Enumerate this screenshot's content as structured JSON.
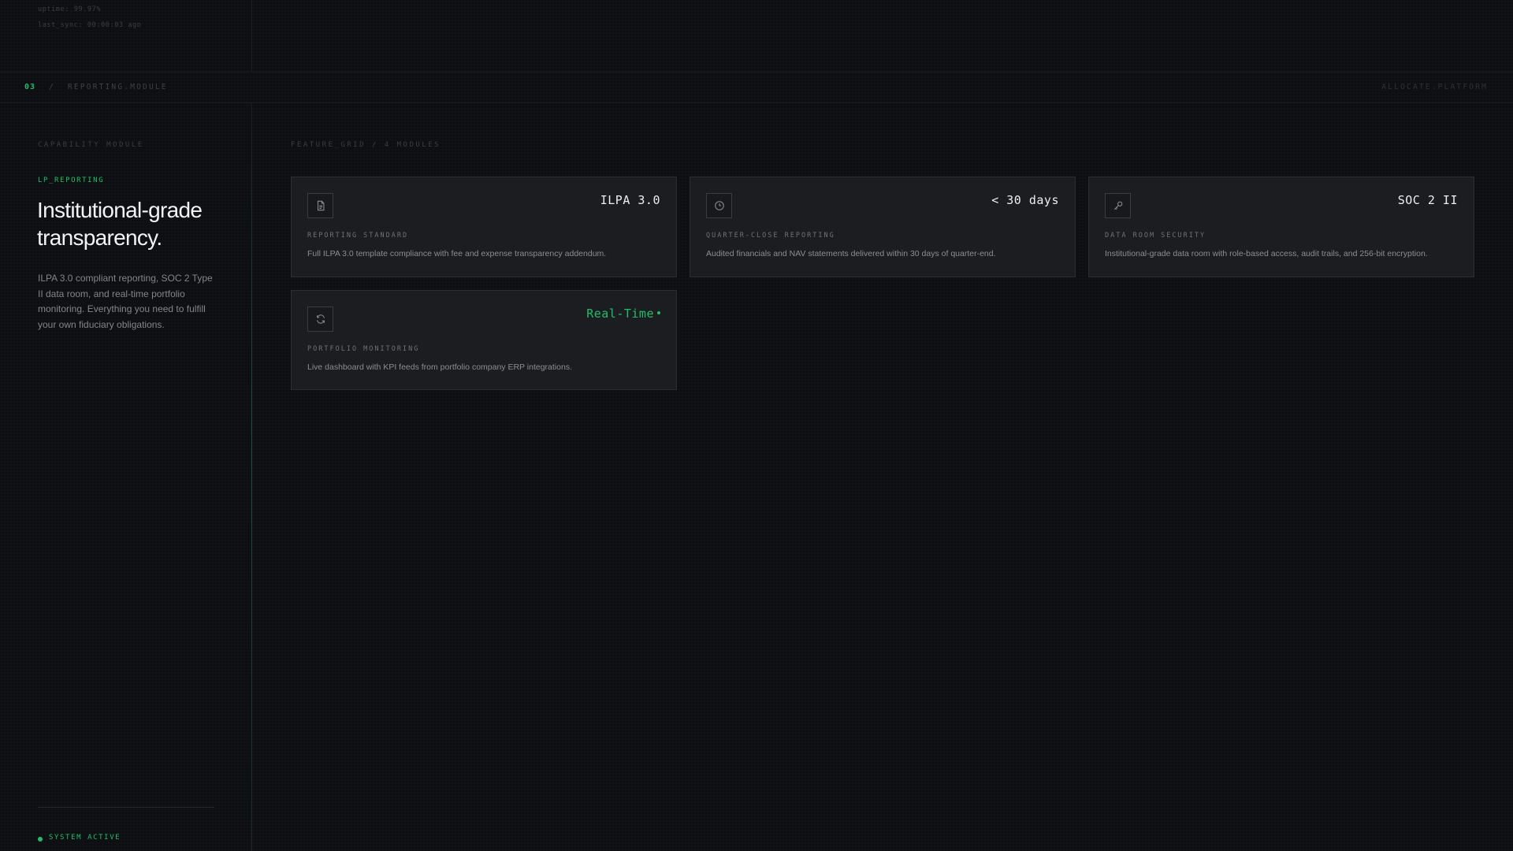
{
  "status": {
    "uptime": "uptime: 99.97%",
    "last_sync": "last_sync: 00:00:03 ago"
  },
  "breadcrumb": {
    "number": "03",
    "separator": "/",
    "label": "REPORTING.MODULE",
    "brand": "ALLOCATE.PLATFORM"
  },
  "sidebar": {
    "section_label": "CAPABILITY MODULE",
    "tag": "LP_REPORTING",
    "headline": "Institutional-grade transparency.",
    "description": "ILPA 3.0 compliant reporting, SOC 2 Type II data room, and real-time portfolio monitoring. Everything you need to fulfill your own fiduciary obligations.",
    "system_status": "SYSTEM ACTIVE"
  },
  "main": {
    "grid_label": "FEATURE_GRID / 4 MODULES",
    "cards": [
      {
        "icon": "document-icon",
        "metric": "ILPA 3.0",
        "label": "REPORTING STANDARD",
        "description": "Full ILPA 3.0 template compliance with fee and expense transparency addendum."
      },
      {
        "icon": "clock-icon",
        "metric": "< 30 days",
        "label": "QUARTER-CLOSE REPORTING",
        "description": "Audited financials and NAV statements delivered within 30 days of quarter-end."
      },
      {
        "icon": "key-icon",
        "metric": "SOC 2 II",
        "label": "DATA ROOM SECURITY",
        "description": "Institutional-grade data room with role-based access, audit trails, and 256-bit encryption."
      },
      {
        "icon": "refresh-icon",
        "metric": "Real-Time",
        "label": "PORTFOLIO MONITORING",
        "description": "Live dashboard with KPI feeds from portfolio company ERP integrations."
      }
    ]
  },
  "colors": {
    "accent": "#1fbf6a",
    "background": "#0e0f12",
    "card": "#1c1d21"
  }
}
